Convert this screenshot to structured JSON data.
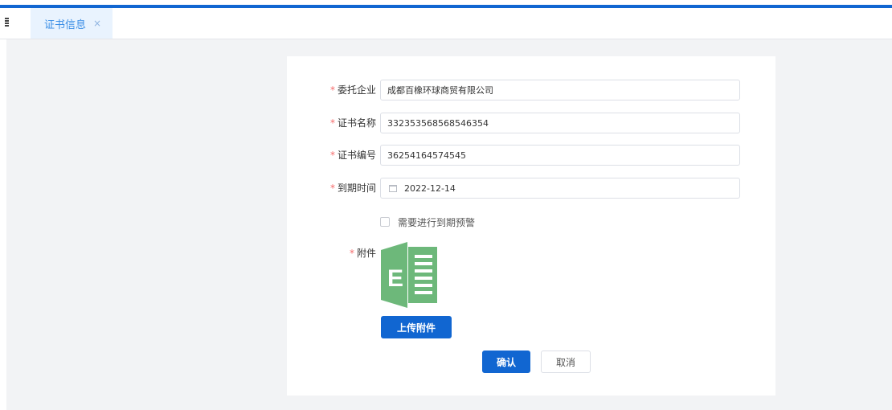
{
  "tabs": [
    {
      "label": "证书信息",
      "close": "×",
      "active": true
    }
  ],
  "form": {
    "company": {
      "label": "委托企业",
      "value": "成都百橡环球商贸有限公司",
      "required": "*"
    },
    "cert_name": {
      "label": "证书名称",
      "value": "332353568568546354",
      "required": "*"
    },
    "cert_no": {
      "label": "证书编号",
      "value": "36254164574545",
      "required": "*"
    },
    "expire": {
      "label": "到期时间",
      "value": "2022-12-14",
      "required": "*",
      "icon": "calendar-icon"
    },
    "warning_checkbox": {
      "label": "需要进行到期预警",
      "checked": false
    },
    "attachment": {
      "label": "附件",
      "required": "*",
      "icon": "excel-file-icon",
      "icon_letter": "E"
    },
    "upload_button": "上传附件",
    "confirm_button": "确认",
    "cancel_button": "取消"
  },
  "colors": {
    "accent": "#1166d1",
    "required": "#f56c6c",
    "tab_bg": "#e9f3fe",
    "tab_text": "#3a8ee6",
    "excel_green": "#6db87a",
    "page_bg": "#f2f3f5"
  }
}
